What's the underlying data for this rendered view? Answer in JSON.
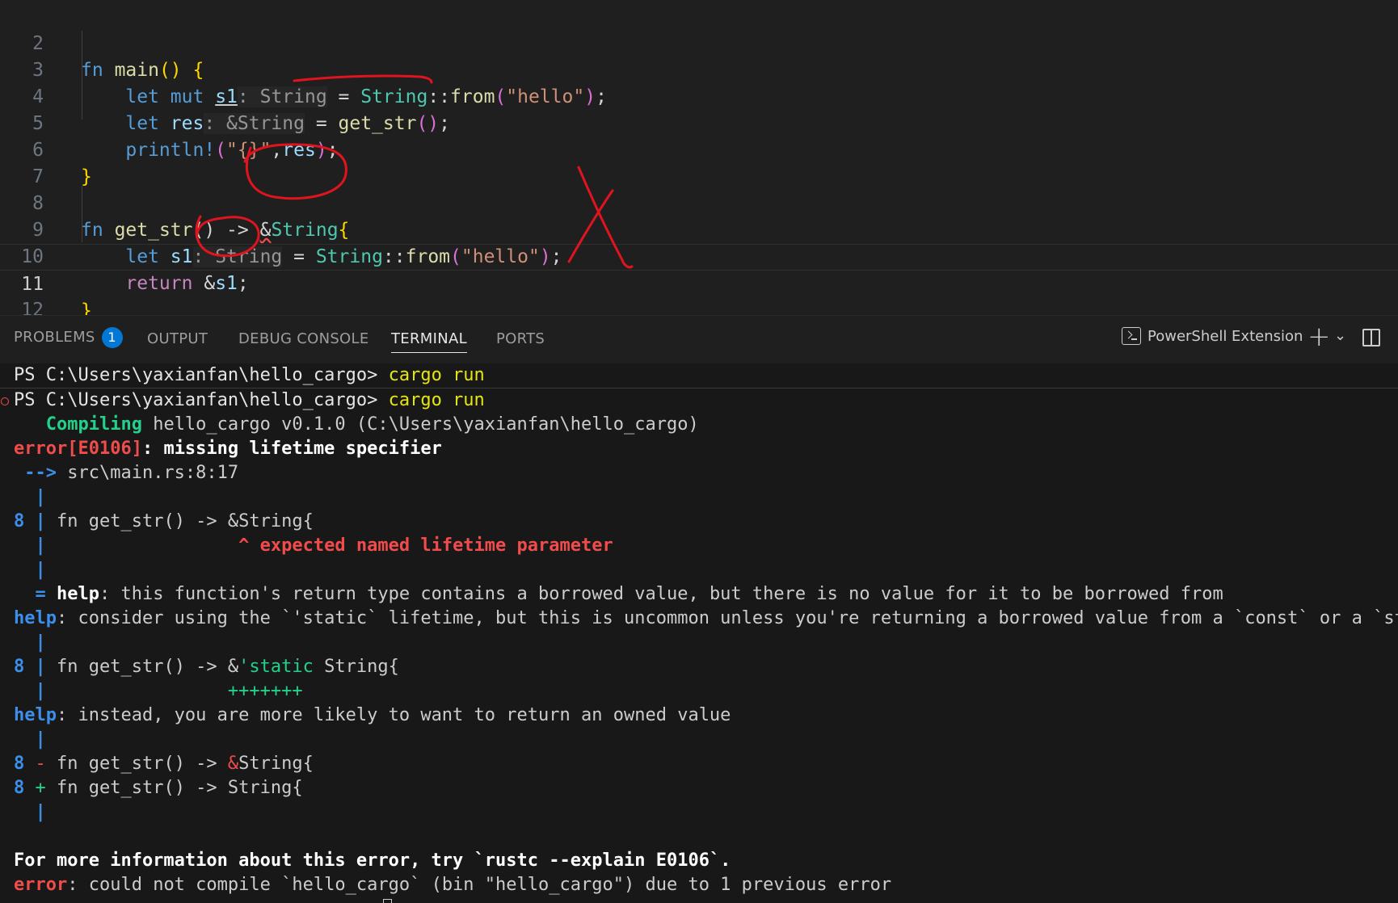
{
  "editor": {
    "lines": [
      {
        "n": "2"
      },
      {
        "n": "3"
      },
      {
        "n": "4"
      },
      {
        "n": "5"
      },
      {
        "n": "6"
      },
      {
        "n": "7"
      },
      {
        "n": "8"
      },
      {
        "n": "9"
      },
      {
        "n": "10"
      },
      {
        "n": "11"
      },
      {
        "n": "12"
      }
    ],
    "code": {
      "l2": {
        "kw": "fn",
        "name": "main",
        "rest": "()",
        "brace": "{"
      },
      "l3": {
        "kw1": "let",
        "kw2": "mut",
        "var": "s1",
        "hint": ": String",
        "eq": " = ",
        "type": "String",
        "sep": "::",
        "fn": "from",
        "str": "\"hello\"",
        "end": ");"
      },
      "l4": {
        "kw": "let",
        "var": "res",
        "hint": ": &String",
        "eq": " = ",
        "fn": "get_str",
        "call": "()",
        "end": ";"
      },
      "l5": {
        "macro": "println!",
        "open": "(",
        "str": "\"{}\"",
        "comma": ",",
        "var": "res",
        "end": ");"
      },
      "l6": {
        "brace": "}"
      },
      "l8": {
        "kw": "fn",
        "name": "get_str",
        "sig": "() -> ",
        "amp": "&",
        "type": "String",
        "brace": "{"
      },
      "l9": {
        "kw": "let",
        "var": "s1",
        "hint": ": String",
        "eq": " = ",
        "type": "String",
        "sep": "::",
        "fn": "from",
        "str": "\"hello\"",
        "end": ");"
      },
      "l10": {
        "kw": "return",
        "amp": " &",
        "var": "s1",
        "end": ";"
      },
      "l11": {
        "brace": "}"
      }
    }
  },
  "panel": {
    "tabs": [
      {
        "label": "PROBLEMS",
        "badge": "1"
      },
      {
        "label": "OUTPUT"
      },
      {
        "label": "DEBUG CONSOLE"
      },
      {
        "label": "TERMINAL"
      },
      {
        "label": "PORTS"
      }
    ],
    "terminal_name": "PowerShell Extension",
    "add_glyph": "+",
    "dropdown_glyph": "⌄"
  },
  "terminal": {
    "prompt": "PS C:\\Users\\yaxianfan\\hello_cargo>",
    "cmd": "cargo run",
    "compiling": "   Compiling",
    "compiling_rest": " hello_cargo v0.1.0 (C:\\Users\\yaxianfan\\hello_cargo)",
    "error_code": "error[E0106]",
    "error_msg": ": missing lifetime specifier",
    "arrow": " -->",
    "location": " src\\main.rs:8:17",
    "gutter": "  |",
    "ln8": "8",
    "bar": " |",
    "code_sig": " fn get_str() -> &String{",
    "caret": "                  ^ expected named lifetime parameter",
    "eq_help_prefix": "  = ",
    "help_word": "help",
    "eq_help_msg": ": this function's return type contains a borrowed value, but there is no value for it to be borrowed from",
    "help1": ": consider using the `'static` lifetime, but this is uncommon unless you're returning a borrowed value from a `const` or a `stat",
    "code_static_a": " fn get_str() -> &",
    "code_static_b": "'static",
    "code_static_c": " String{",
    "plus_marks": "                 +++++++",
    "help2": ": instead, you are more likely to want to return an owned value",
    "minus": " -",
    "minus_code_a": " fn get_str() -> ",
    "minus_code_b": "&",
    "minus_code_c": "String{",
    "plus": " +",
    "plus_code": " fn get_str() -> String{",
    "more_info": "For more information about this error, try `rustc --explain E0106`.",
    "error_word": "error",
    "final_error": ": could not compile `hello_cargo` (bin \"hello_cargo\") due to 1 previous error"
  }
}
